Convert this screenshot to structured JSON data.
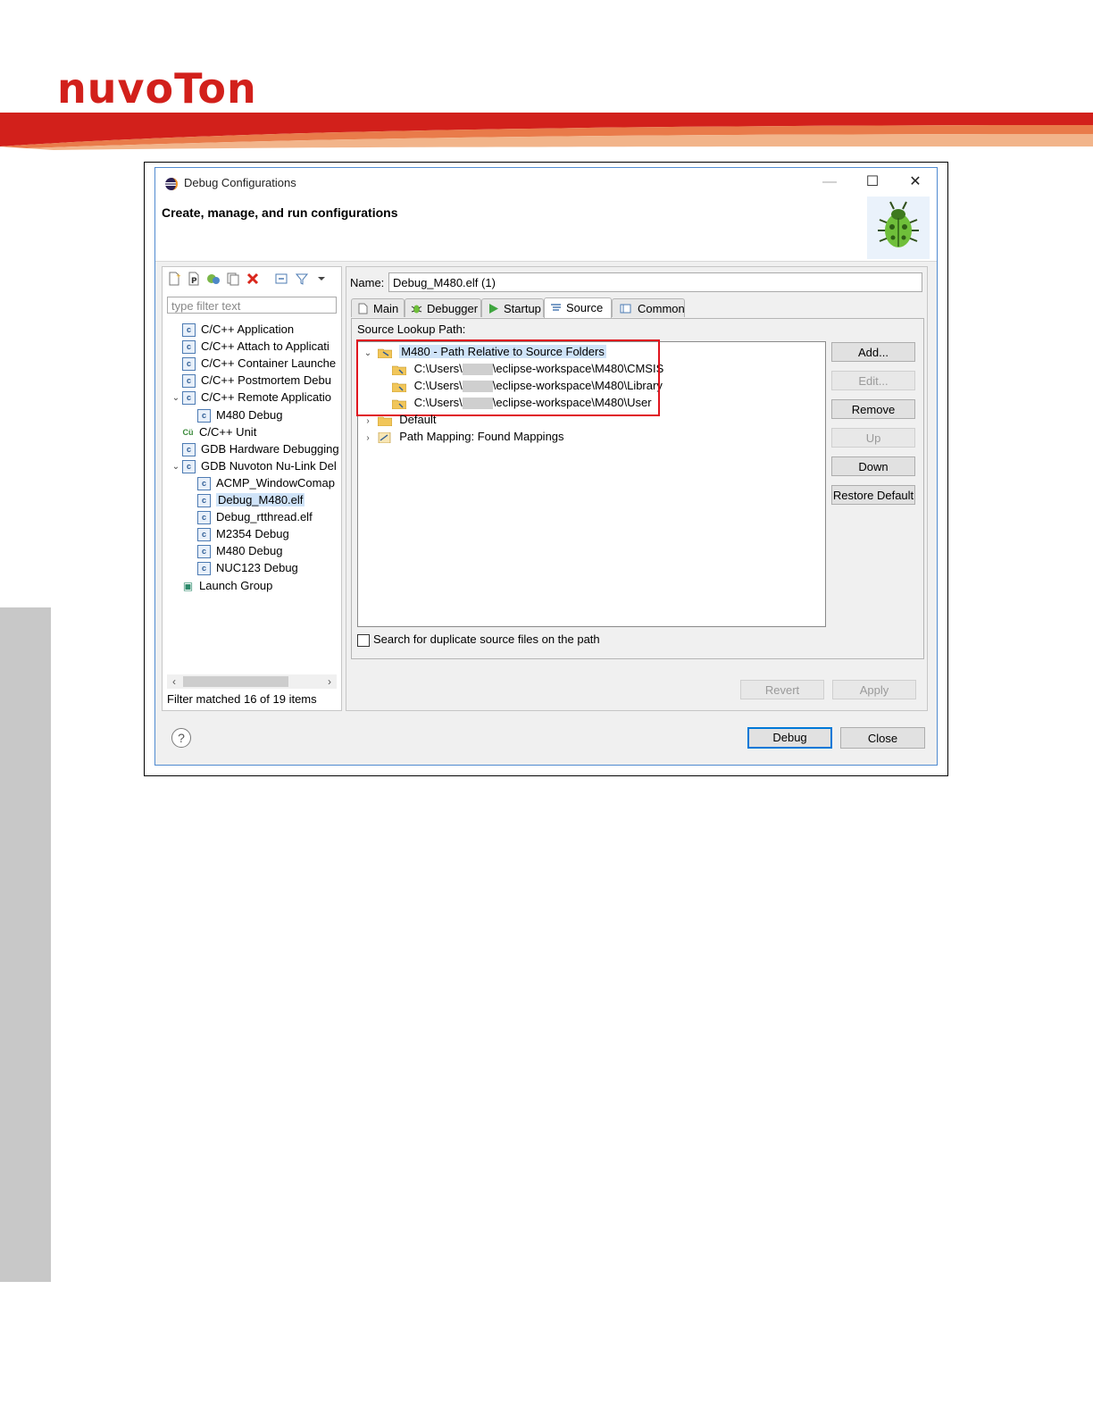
{
  "brand": {
    "logo_text": "nuvoTon",
    "accent": "#d2201b"
  },
  "window": {
    "title": "Debug Configurations",
    "header": "Create, manage, and run configurations",
    "buttons": {
      "minimize": "—",
      "maximize": "☐",
      "close": "✕"
    }
  },
  "left_panel": {
    "toolbar_icons": [
      "new-configuration-icon",
      "new-prototype-icon",
      "export-icon",
      "duplicate-icon",
      "delete-icon",
      "collapse-all-icon",
      "filter-icon",
      "view-menu-icon"
    ],
    "filter_placeholder": "type filter text",
    "tree": [
      {
        "label": "C/C++ Application",
        "icon": "c-icon"
      },
      {
        "label": "C/C++ Attach to Applicati",
        "icon": "c-icon"
      },
      {
        "label": "C/C++ Container Launche",
        "icon": "c-icon"
      },
      {
        "label": "C/C++ Postmortem Debu",
        "icon": "c-icon"
      },
      {
        "label": "C/C++ Remote Applicatio",
        "icon": "c-icon"
      },
      {
        "label": "M480 Debug",
        "icon": "c-icon"
      },
      {
        "label": "C/C++ Unit",
        "icon": "cu-icon"
      },
      {
        "label": "GDB Hardware Debugging",
        "icon": "c-icon"
      },
      {
        "label": "GDB Nuvoton Nu-Link Del",
        "icon": "c-icon"
      },
      {
        "label": "ACMP_WindowComap",
        "icon": "c-icon"
      },
      {
        "label": "Debug_M480.elf",
        "icon": "c-icon"
      },
      {
        "label": "Debug_rtthread.elf",
        "icon": "c-icon"
      },
      {
        "label": "M2354 Debug",
        "icon": "c-icon"
      },
      {
        "label": "M480 Debug",
        "icon": "c-icon"
      },
      {
        "label": "NUC123 Debug",
        "icon": "c-icon"
      },
      {
        "label": "Launch Group",
        "icon": "launch-group-icon"
      }
    ],
    "status": "Filter matched 16 of 19 items"
  },
  "right_panel": {
    "name_label": "Name:",
    "name_value": "Debug_M480.elf (1)",
    "tabs": [
      "Main",
      "Debugger",
      "Startup",
      "Source",
      "Common"
    ],
    "active_tab": "Source",
    "source_lookup_label": "Source Lookup Path:",
    "source_tree": {
      "root": "M480 - Path Relative to Source Folders",
      "children": [
        {
          "prefix": "C:\\Users\\",
          "suffix": "\\eclipse-workspace\\M480\\CMSIS"
        },
        {
          "prefix": "C:\\Users\\",
          "suffix": "\\eclipse-workspace\\M480\\Library"
        },
        {
          "prefix": "C:\\Users\\",
          "suffix": "\\eclipse-workspace\\M480\\User"
        }
      ],
      "others": [
        "Default",
        "Path Mapping: Found Mappings"
      ]
    },
    "side_buttons": [
      "Add...",
      "Edit...",
      "Remove",
      "Up",
      "Down",
      "Restore Default"
    ],
    "duplicate_checkbox": "Search for duplicate source files on the path",
    "revert": "Revert",
    "apply": "Apply"
  },
  "footer": {
    "help": "?",
    "debug": "Debug",
    "close": "Close"
  }
}
